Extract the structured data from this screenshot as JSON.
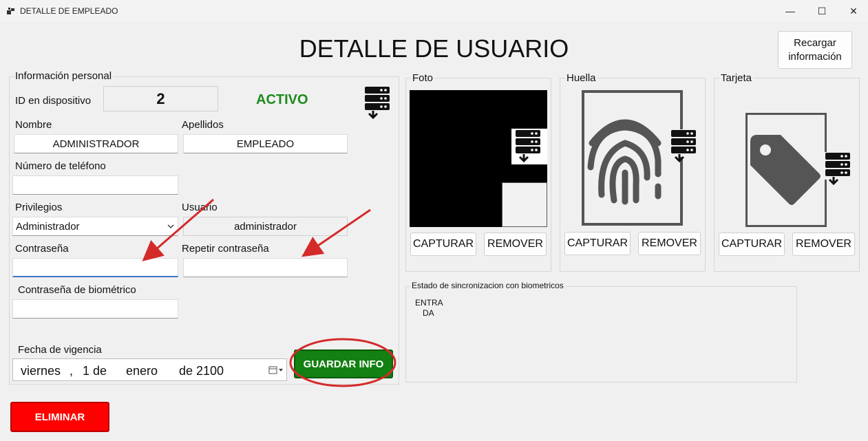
{
  "window": {
    "title": "DETALLE DE EMPLEADO",
    "minimize": "—",
    "maximize": "☐",
    "close": "✕"
  },
  "page_title": "DETALLE DE USUARIO",
  "reload_button": "Recargar información",
  "personal": {
    "legend": "Información personal",
    "device_id_label": "ID en dispositivo",
    "device_id_value": "2",
    "status": "ACTIVO",
    "nombre_label": "Nombre",
    "nombre_value": "ADMINISTRADOR",
    "apellidos_label": "Apellidos",
    "apellidos_value": "EMPLEADO",
    "telefono_label": "Número de teléfono",
    "telefono_value": "",
    "privilegios_label": "Privilegios",
    "privilegios_value": "Administrador",
    "usuario_label": "Usuario",
    "usuario_value": "administrador",
    "password_label": "Contraseña",
    "password_value": "",
    "repeat_password_label": "Repetir contraseña",
    "repeat_password_value": "",
    "bio_password_label": "Contraseña de biométrico",
    "bio_password_value": "",
    "vigencia_label": "Fecha de vigencia",
    "vigencia_day": "viernes",
    "vigencia_sep": ",",
    "vigencia_date": "1 de",
    "vigencia_month": "enero",
    "vigencia_year": "de 2100",
    "save_button": "GUARDAR INFO"
  },
  "foto": {
    "legend": "Foto",
    "capture": "CAPTURAR",
    "remove": "REMOVER"
  },
  "huella": {
    "legend": "Huella",
    "capture": "CAPTURAR",
    "remove": "REMOVER"
  },
  "tarjeta": {
    "legend": "Tarjeta",
    "capture": "CAPTURAR",
    "remove": "REMOVER"
  },
  "sync": {
    "legend": "Estado de sincronizacion con biometricos",
    "line1": "ENTRA",
    "line2": "DA"
  },
  "delete_button": "ELIMINAR",
  "colors": {
    "status_green": "#1e8a1e",
    "save_green": "#128012",
    "delete_red": "#ff0000",
    "annotation_red": "#d42a2a"
  }
}
